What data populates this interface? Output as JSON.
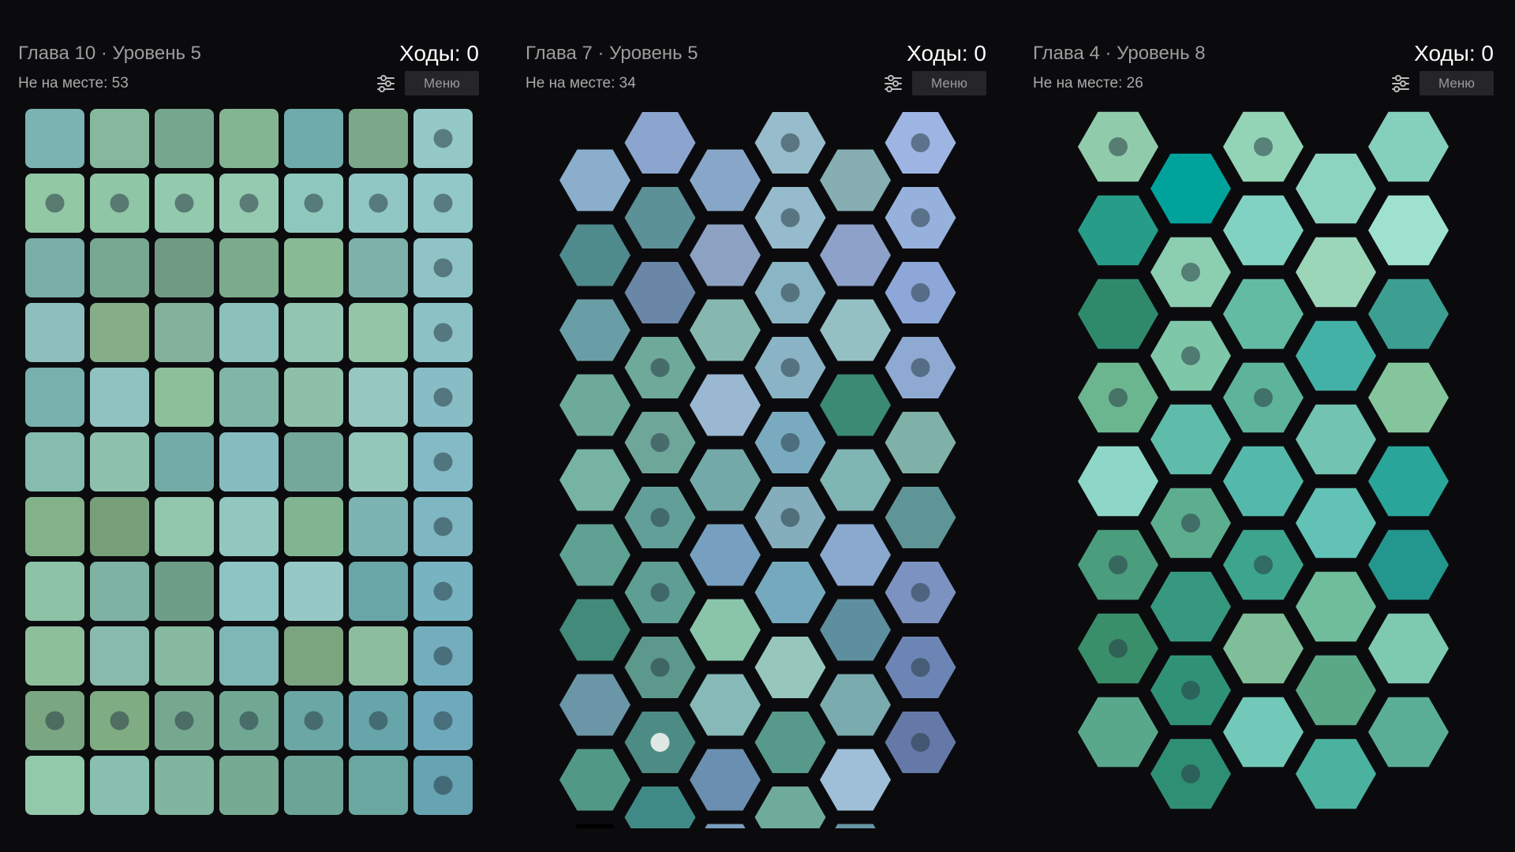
{
  "panels": [
    {
      "level_title": "Глава 10 · Уровень 5",
      "moves_label": "Ходы: 0",
      "misplaced_label": "Не на месте: 53",
      "menu_label": "Меню",
      "settings_icon": "sliders-icon",
      "board": {
        "shape": "square",
        "columns": 7,
        "rows": 11,
        "tiles": [
          [
            "#7ab3b1",
            "#85b89c",
            "#76a78e",
            "#84b592",
            "#6fabab",
            "#7ba889",
            "#94c9c8"
          ],
          [
            "#93c8a5",
            "#8fc6a5",
            "#93c9ac",
            "#95cab1",
            "#8ec8bc",
            "#90c6c3",
            "#93c8c9"
          ],
          [
            "#7aafa9",
            "#78a891",
            "#709b82",
            "#7cab8b",
            "#89ba96",
            "#7db1aa",
            "#8fc3c6"
          ],
          [
            "#8ebfbd",
            "#85ad87",
            "#84b19c",
            "#8cc0ba",
            "#92c5b2",
            "#92c6a7",
            "#8cc2c6"
          ],
          [
            "#78b0ad",
            "#90c2c2",
            "#8dbf9a",
            "#81b5a6",
            "#8ebfa9",
            "#96c8c1",
            "#88bdc6"
          ],
          [
            "#86bbb0",
            "#8dc1ae",
            "#73aca6",
            "#86bcbf",
            "#74a898",
            "#93c7b7",
            "#83bac5"
          ],
          [
            "#83b28a",
            "#77a07a",
            "#92c6ad",
            "#92c7c0",
            "#81b592",
            "#7cb3b3",
            "#7eb6c2"
          ],
          [
            "#8ec2a7",
            "#7eb2a2",
            "#6e9e87",
            "#8fc4c4",
            "#96c9c5",
            "#69a6a7",
            "#78b3c1"
          ],
          [
            "#8dbf9b",
            "#88bbae",
            "#86b9a0",
            "#7fb7b7",
            "#7ba57f",
            "#8cbd9d",
            "#74aebe"
          ],
          [
            "#7aa681",
            "#7fac83",
            "#76a88f",
            "#70a894",
            "#6aa7a5",
            "#66a6aa",
            "#6eaabb"
          ],
          [
            "#93c9ab",
            "#89bfae",
            "#81b59f",
            "#77aa93",
            "#6ca597",
            "#69a7a0",
            "#66a3b3"
          ]
        ],
        "fixed": [
          [
            0,
            0,
            0,
            0,
            0,
            0,
            1
          ],
          [
            1,
            1,
            1,
            1,
            1,
            1,
            1
          ],
          [
            0,
            0,
            0,
            0,
            0,
            0,
            1
          ],
          [
            0,
            0,
            0,
            0,
            0,
            0,
            1
          ],
          [
            0,
            0,
            0,
            0,
            0,
            0,
            1
          ],
          [
            0,
            0,
            0,
            0,
            0,
            0,
            1
          ],
          [
            0,
            0,
            0,
            0,
            0,
            0,
            1
          ],
          [
            0,
            0,
            0,
            0,
            0,
            0,
            1
          ],
          [
            0,
            0,
            0,
            0,
            0,
            0,
            1
          ],
          [
            1,
            1,
            1,
            1,
            1,
            1,
            1
          ],
          [
            0,
            0,
            0,
            0,
            0,
            0,
            1
          ]
        ]
      }
    },
    {
      "level_title": "Глава 7 · Уровень 5",
      "moves_label": "Ходы: 0",
      "misplaced_label": "Не на месте: 34",
      "menu_label": "Меню",
      "settings_icon": "sliders-icon",
      "board": {
        "shape": "hex",
        "columns": 6,
        "rows": 10,
        "first_column_offset": "low",
        "tiles": [
          [
            "#8aaecb",
            "#8ca5cf",
            "#88a6c8",
            "#97bccb",
            "#86aeb3",
            "#9eb5e4"
          ],
          [
            "#4f8a8d",
            "#5b9197",
            "#8da1c3",
            "#96bbcd",
            "#8ea1c9",
            "#97b1dd"
          ],
          [
            "#6a9ea6",
            "#6a87a8",
            "#86b8b0",
            "#8ab5c4",
            "#94c0c4",
            "#8da8d8"
          ],
          [
            "#6eaa9a",
            "#6ea999",
            "#9bb8d3",
            "#8ab4c5",
            "#3a8a74",
            "#8eaad2"
          ],
          [
            "#76b3a3",
            "#6ea699",
            "#73a9a9",
            "#7aaac0",
            "#7fb5b3",
            "#7fb1a8"
          ],
          [
            "#5fa192",
            "#639f99",
            "#77a0c0",
            "#84aebc",
            "#8ba9cf",
            "#5f9597"
          ],
          [
            "#428a79",
            "#5f9e94",
            "#8ac5aa",
            "#75a9bd",
            "#5e8f9f",
            "#7c92c1"
          ],
          [
            "#6b96a8",
            "#5c988c",
            "#87b9b9",
            "#97c6bd",
            "#7aabae",
            "#6d85b4"
          ],
          [
            "#519986",
            "#4c8c84",
            "#6b8fb0",
            "#57998a",
            "#9fbfd9",
            "#6579a9"
          ],
          [
            "#000000",
            "#3f8a86",
            "#7a9ebf",
            "#6fab99",
            "#6896a6",
            "#000000"
          ]
        ],
        "visible": [
          [
            1,
            1,
            1,
            1,
            1,
            1
          ],
          [
            1,
            1,
            1,
            1,
            1,
            1
          ],
          [
            1,
            1,
            1,
            1,
            1,
            1
          ],
          [
            1,
            1,
            1,
            1,
            1,
            1
          ],
          [
            1,
            1,
            1,
            1,
            1,
            1
          ],
          [
            1,
            1,
            1,
            1,
            1,
            1
          ],
          [
            1,
            1,
            1,
            1,
            1,
            1
          ],
          [
            1,
            1,
            1,
            1,
            1,
            1
          ],
          [
            1,
            1,
            1,
            1,
            1,
            1
          ],
          [
            1,
            1,
            1,
            1,
            1,
            0
          ]
        ],
        "fixed": [
          [
            0,
            0,
            0,
            1,
            0,
            1
          ],
          [
            0,
            0,
            0,
            1,
            0,
            1
          ],
          [
            0,
            0,
            0,
            1,
            0,
            1
          ],
          [
            0,
            1,
            0,
            1,
            0,
            1
          ],
          [
            0,
            1,
            0,
            1,
            0,
            0
          ],
          [
            0,
            1,
            0,
            1,
            0,
            0
          ],
          [
            0,
            1,
            0,
            0,
            0,
            1
          ],
          [
            0,
            1,
            0,
            0,
            0,
            1
          ],
          [
            0,
            2,
            0,
            0,
            0,
            1
          ],
          [
            0,
            0,
            0,
            0,
            0,
            0
          ]
        ]
      }
    },
    {
      "level_title": "Глава 4 · Уровень 8",
      "moves_label": "Ходы: 0",
      "misplaced_label": "Не на месте: 26",
      "menu_label": "Меню",
      "settings_icon": "sliders-icon",
      "board": {
        "shape": "hex",
        "columns": 5,
        "rows": 9,
        "first_column_offset": "low",
        "tiles": [
          [
            "#90ccab",
            "#00a39c",
            "#93d4b6",
            "#8dd4c0",
            "#85cfbd"
          ],
          [
            "#279d89",
            "#8cceb0",
            "#82d2c3",
            "#9bd6b9",
            "#9ee1cc"
          ],
          [
            "#2f8a6c",
            "#7fc7a9",
            "#63bba3",
            "#44b1a7",
            "#3c9f92"
          ],
          [
            "#6bb58f",
            "#5fbcaa",
            "#5db499",
            "#72c3b1",
            "#84c59d"
          ],
          [
            "#8ed7c8",
            "#5cae8f",
            "#54b9ab",
            "#61c2b5",
            "#29a59a"
          ],
          [
            "#4a9d7d",
            "#36987f",
            "#3da58d",
            "#6fbd9b",
            "#23978d"
          ],
          [
            "#3a8f6b",
            "#2f9277",
            "#7ebe98",
            "#5aa886",
            "#7dcab0"
          ],
          [
            "#5aa88c",
            "#2f8f74",
            "#72c9b9",
            "#4bb29f",
            "#5aae95"
          ],
          [
            "#000000",
            "#000000",
            "#000000",
            "#000000",
            "#000000"
          ]
        ],
        "visible": [
          [
            1,
            1,
            1,
            1,
            1
          ],
          [
            1,
            1,
            1,
            1,
            1
          ],
          [
            1,
            1,
            1,
            1,
            1
          ],
          [
            1,
            1,
            1,
            1,
            1
          ],
          [
            1,
            1,
            1,
            1,
            1
          ],
          [
            1,
            1,
            1,
            1,
            1
          ],
          [
            1,
            1,
            1,
            1,
            1
          ],
          [
            1,
            1,
            1,
            1,
            1
          ],
          [
            0,
            0,
            0,
            0,
            0
          ]
        ],
        "fixed": [
          [
            1,
            0,
            1,
            0,
            0
          ],
          [
            0,
            1,
            0,
            0,
            0
          ],
          [
            0,
            1,
            0,
            0,
            0
          ],
          [
            1,
            0,
            1,
            0,
            0
          ],
          [
            0,
            1,
            0,
            0,
            0
          ],
          [
            1,
            0,
            1,
            0,
            0
          ],
          [
            1,
            1,
            0,
            0,
            0
          ],
          [
            0,
            1,
            0,
            0,
            0
          ],
          [
            0,
            0,
            0,
            0,
            0
          ]
        ]
      }
    }
  ]
}
